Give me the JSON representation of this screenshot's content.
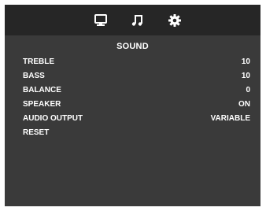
{
  "tabs": [
    {
      "id": "display",
      "icon": "monitor-icon"
    },
    {
      "id": "sound",
      "icon": "music-note-icon"
    },
    {
      "id": "setup",
      "icon": "gear-icon"
    }
  ],
  "active_tab": "sound",
  "title": "SOUND",
  "menu": [
    {
      "label": "TREBLE",
      "value": "10"
    },
    {
      "label": "BASS",
      "value": "10"
    },
    {
      "label": "BALANCE",
      "value": "0"
    },
    {
      "label": "SPEAKER",
      "value": "ON"
    },
    {
      "label": "AUDIO OUTPUT",
      "value": "VARIABLE"
    },
    {
      "label": "RESET",
      "value": ""
    }
  ],
  "colors": {
    "panel": "#3a3a3a",
    "topbar": "#262626",
    "text": "#ffffff"
  }
}
